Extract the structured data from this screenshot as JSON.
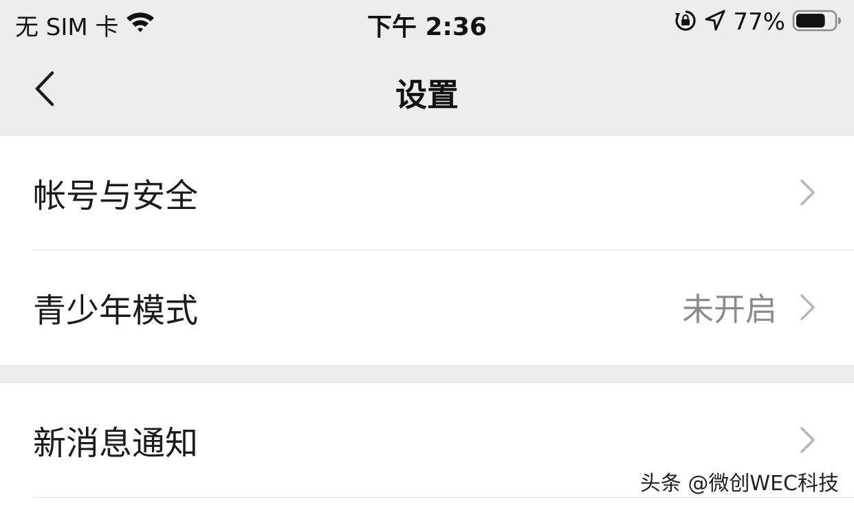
{
  "status_bar": {
    "carrier": "无 SIM 卡",
    "time": "下午 2:36",
    "battery_percent": "77%",
    "battery_level": 0.77,
    "icons": [
      "wifi-icon",
      "rotation-lock-icon",
      "location-arrow-icon",
      "battery-icon"
    ]
  },
  "nav": {
    "title": "设置",
    "back_icon": "chevron-left-icon"
  },
  "settings": {
    "group1": [
      {
        "label": "帐号与安全",
        "value": ""
      },
      {
        "label": "青少年模式",
        "value": "未开启"
      }
    ],
    "group2": [
      {
        "label": "新消息通知",
        "value": ""
      }
    ]
  },
  "watermark": "头条 @微创WEC科技",
  "colors": {
    "background": "#ededed",
    "card": "#ffffff",
    "value_text": "#8a8a8a",
    "chevron": "#b5b5b5"
  }
}
